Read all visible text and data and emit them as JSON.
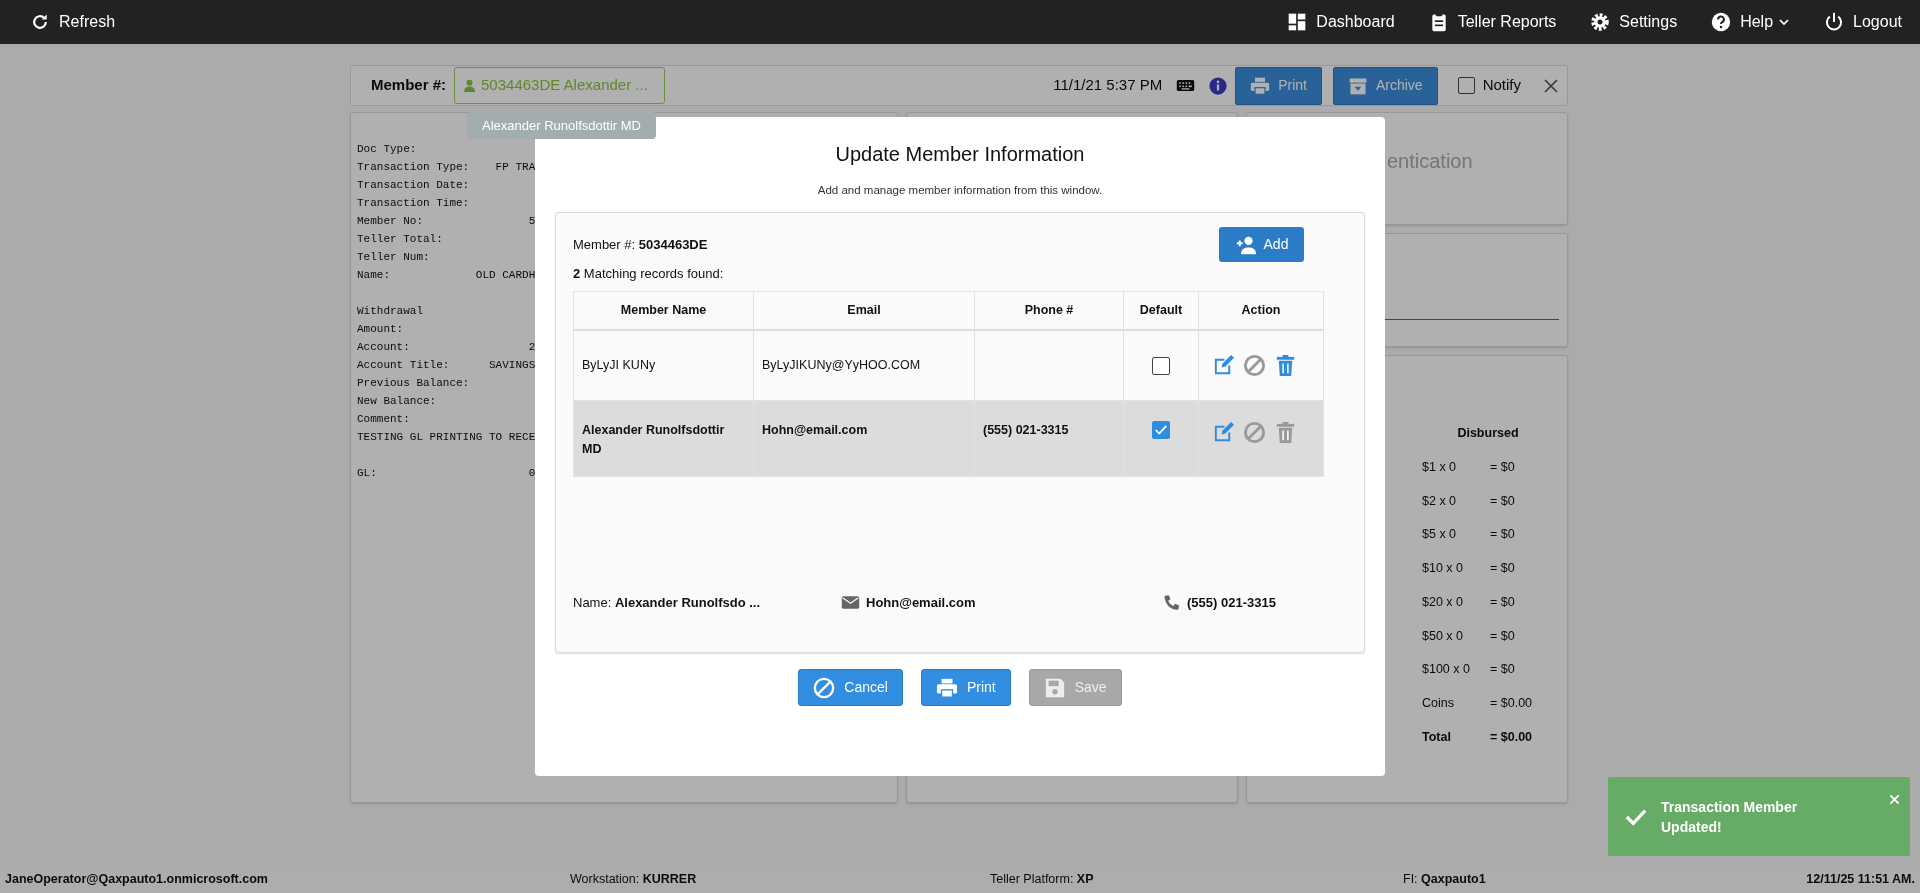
{
  "navbar": {
    "refresh": "Refresh",
    "items": [
      {
        "label": "Dashboard",
        "dropdown": false
      },
      {
        "label": "Teller Reports",
        "dropdown": false
      },
      {
        "label": "Settings",
        "dropdown": false
      },
      {
        "label": "Help",
        "dropdown": true
      },
      {
        "label": "Logout",
        "dropdown": false
      }
    ]
  },
  "member_bar": {
    "label": "Member #:",
    "member_chip": "5034463DE Alexander ...",
    "tooltip": "Alexander Runolfsdottir MD",
    "datetime": "11/1/21 5:37 PM",
    "buttons": [
      "Print",
      "Archive"
    ],
    "notify": {
      "label": "Notify",
      "checked": false
    }
  },
  "receipt": {
    "sections": [
      [
        "Doc Type:",
        "Transaction Type:    FP TRA",
        "Transaction Date:",
        "Transaction Time:",
        "Member No:                5",
        "Teller Total:",
        "Teller Num:",
        "Name:             OLD CARDH"
      ],
      [
        "Withdrawal",
        "Amount:",
        "Account:                  2",
        "Account Title:      SAVINGS",
        "Previous Balance:",
        "New Balance:",
        "Comment:",
        "TESTING GL PRINTING TO RECE"
      ],
      [
        "GL:                       0"
      ]
    ]
  },
  "right_panels": {
    "heading_fragment": "entication",
    "cash": {
      "heading": "Disbursed",
      "rows": [
        {
          "denomination": "$1 x 0",
          "amount": "= $0",
          "total": false
        },
        {
          "denomination": "$2 x 0",
          "amount": "= $0",
          "total": false
        },
        {
          "denomination": "$5 x 0",
          "amount": "= $0",
          "total": false
        },
        {
          "denomination": "$10 x 0",
          "amount": "= $0",
          "total": false
        },
        {
          "denomination": "$20 x 0",
          "amount": "= $0",
          "total": false
        },
        {
          "denomination": "$50 x 0",
          "amount": "= $0",
          "total": false
        },
        {
          "denomination": "$100 x 0",
          "amount": "= $0",
          "total": false
        },
        {
          "denomination": "Coins",
          "amount": "= $0.00",
          "total": false
        },
        {
          "denomination": "Total",
          "amount": "= $0.00",
          "total": true
        }
      ]
    }
  },
  "modal": {
    "title": "Update Member Information",
    "subtitle": "Add and manage member information from this window.",
    "member_line": "Member #: **5034463DE**",
    "add_button": "Add",
    "matches": "**2** Matching records found:",
    "columns": [
      "Member Name",
      "Email",
      "Phone #",
      "Default",
      "Action"
    ],
    "rows": [
      {
        "name": "ByLyJI KUNy",
        "email": "ByLyJIKUNy@YyHOO.COM",
        "default": false,
        "selected": false,
        "actions": [
          {
            "kind": "edit",
            "disabled": false
          },
          {
            "kind": "block",
            "disabled": true
          },
          {
            "kind": "delete",
            "disabled": false
          }
        ]
      },
      {
        "name": "Alexander Runolfsdottir MD",
        "email": "Hohn@email.com",
        "phone": "(555) 021-3315",
        "default": true,
        "selected": true,
        "actions": [
          {
            "kind": "edit",
            "disabled": false
          },
          {
            "kind": "block",
            "disabled": true
          },
          {
            "kind": "delete",
            "disabled": true
          }
        ]
      }
    ],
    "summary": {
      "name": "Name: **Alexander Runolfsdo ...**",
      "email": "Hohn@email.com",
      "phone": "(555) 021-3315"
    },
    "buttons": [
      {
        "kind": "cancel",
        "label": "Cancel",
        "disabled": false
      },
      {
        "kind": "print",
        "label": "Print",
        "disabled": false
      },
      {
        "kind": "save",
        "label": "Save",
        "disabled": true
      }
    ]
  },
  "toast": {
    "message": "Transaction Member Updated!"
  },
  "status_bar": [
    {
      "value": "JaneOperator@Qaxpauto1.onmicrosoft.com"
    },
    {
      "label": "Workstation:",
      "value": "KURRER"
    },
    {
      "label": "Teller Platform:",
      "value": "XP"
    },
    {
      "label": "FI:",
      "value": "Qaxpauto1"
    },
    {
      "value": "12/11/25 11:51 AM."
    }
  ]
}
